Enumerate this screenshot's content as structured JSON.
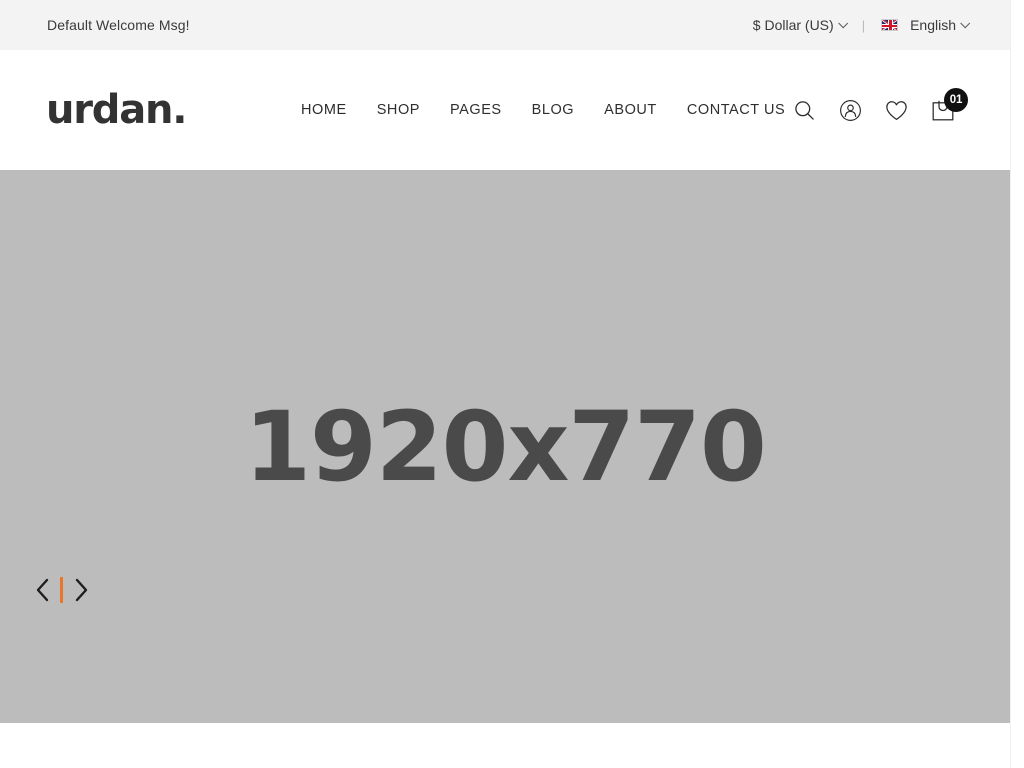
{
  "topbar": {
    "welcome_message": "Default Welcome Msg!",
    "currency": {
      "label": "$ Dollar (US)",
      "icon": "chevron-down-icon"
    },
    "divider": "|",
    "language": {
      "label": "English",
      "flag": "uk-flag-icon",
      "icon": "chevron-down-icon"
    }
  },
  "header": {
    "logo": "urdan.",
    "nav": [
      {
        "label": "HOME",
        "active": true
      },
      {
        "label": "SHOP",
        "active": false
      },
      {
        "label": "PAGES",
        "active": false
      },
      {
        "label": "BLOG",
        "active": false
      },
      {
        "label": "ABOUT",
        "active": false
      },
      {
        "label": "CONTACT US",
        "active": false
      }
    ],
    "icons": {
      "search": "search-icon",
      "account": "account-icon",
      "wishlist": "heart-icon",
      "cart": "shopping-bag-icon",
      "cart_count": "01"
    }
  },
  "hero": {
    "placeholder_text": "1920x770",
    "prev_label": "previous-slide",
    "next_label": "next-slide",
    "separator_color": "#e8772e"
  },
  "colors": {
    "topbar_bg": "#f4f3f3",
    "header_bg": "#ffffff",
    "hero_bg": "#bcbcbc",
    "text_dark": "#2f2f2f",
    "accent_orange": "#e8772e",
    "badge_bg": "#111111"
  }
}
